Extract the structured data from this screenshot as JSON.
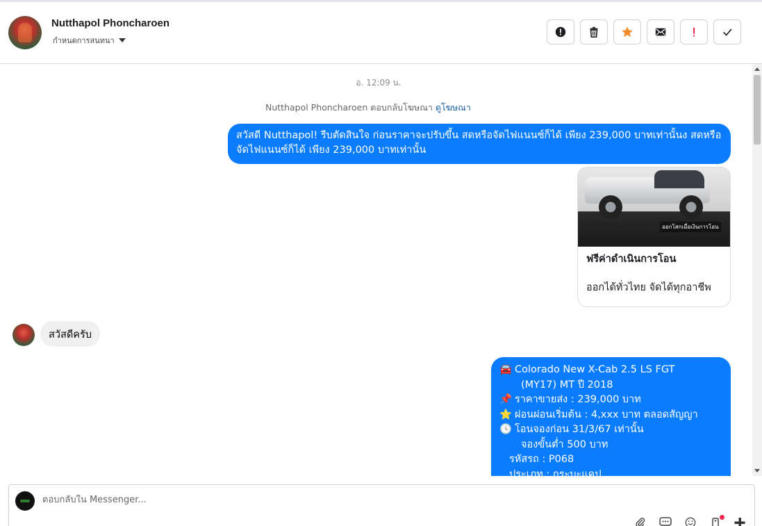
{
  "header": {
    "contact_name": "Nutthapol Phoncharoen",
    "conversation_setting": "กำหนดการสนทนา",
    "actions": [
      {
        "name": "report-spam",
        "icon": "alert-circle-icon"
      },
      {
        "name": "delete",
        "icon": "trash-icon"
      },
      {
        "name": "star",
        "icon": "star-icon",
        "color": "#f5a623"
      },
      {
        "name": "mark-unread",
        "icon": "envelope-icon"
      },
      {
        "name": "priority",
        "icon": "exclamation-icon",
        "color": "#e41e3f"
      },
      {
        "name": "mark-done",
        "icon": "check-icon"
      }
    ]
  },
  "thread": {
    "timestamp": "อ. 12:09 น.",
    "reply_note": {
      "text": "Nutthapol Phoncharoen ตอบกลับโฆษณา",
      "link": "ดูโฆษณา"
    },
    "messages": [
      {
        "direction": "out",
        "text": "สวัสดี Nutthapol! รีบตัดสินใจ ก่อนราคาจะปรับขึ้น สดหรือจัดไฟแนนซ์ก็ได้  เพียง 239,000 บาทเท่านั้นง สดหรือจัดไฟแนนซ์ก็ได้  เพียง 239,000 บาทเท่านั้น"
      },
      {
        "direction": "out",
        "type": "card",
        "image_caption": "ออกโสกเมื่อเงินการโอน",
        "title": "ฟรีค่าดำเนินการโอน",
        "subtitle": "ออกได้ทั่วไทย จัดได้ทุกอาชีพ"
      },
      {
        "direction": "in",
        "text": "สวัสดีครับ"
      },
      {
        "direction": "out",
        "lines": [
          {
            "emoji": "🚘",
            "text": "Colorado New X-Cab 2.5 LS FGT"
          },
          {
            "emoji": "",
            "text": "(MY17) MT ปี 2018"
          },
          {
            "emoji": "📌",
            "text": "ราคาขายส่ง : 239,000 บาท"
          },
          {
            "emoji": "⭐",
            "text": "ผ่อนผ่อนเริ่มต้น : 4,xxx บาท ตลอดสัญญา"
          },
          {
            "emoji": "🕓",
            "text": "โอนจองก่อน 31/3/67 เท่านั้น"
          },
          {
            "emoji": "",
            "text": "จองขั้นต่ำ 500 บาท"
          },
          {
            "emoji": "",
            "text": "รหัสรถ : P068"
          },
          {
            "emoji": "",
            "text": "ประเภท : กระบะแคป"
          }
        ]
      }
    ]
  },
  "composer": {
    "placeholder": "ตอบกลับใน Messenger..."
  }
}
